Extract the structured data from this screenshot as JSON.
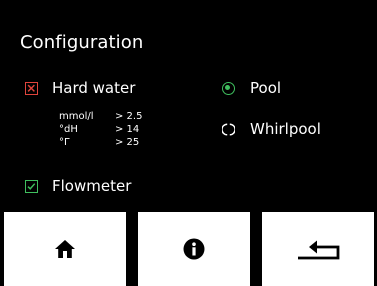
{
  "header": {
    "title": "Configuration"
  },
  "options": {
    "hard_water": {
      "label": "Hard water",
      "checked": false,
      "indicator_color": "#e0443c"
    },
    "flowmeter": {
      "label": "Flowmeter",
      "checked": true,
      "indicator_color": "#3fbf5e"
    }
  },
  "hardness_thresholds": [
    {
      "unit": "mmol/l",
      "value": "> 2.5"
    },
    {
      "unit": "°dH",
      "value": "> 14"
    },
    {
      "unit": "°Г",
      "value": "> 25"
    }
  ],
  "mode": {
    "selected": "Pool",
    "options": [
      {
        "label": "Pool",
        "selected": true
      },
      {
        "label": "Whirlpool",
        "selected": false
      }
    ]
  },
  "navigation": {
    "buttons": [
      {
        "icon": "home-icon"
      },
      {
        "icon": "info-icon"
      },
      {
        "icon": "back-icon"
      }
    ]
  },
  "colors": {
    "background": "#000000",
    "text": "#ffffff",
    "selected": "#3fbf5e",
    "error": "#e0443c",
    "nav_button": "#ffffff"
  }
}
